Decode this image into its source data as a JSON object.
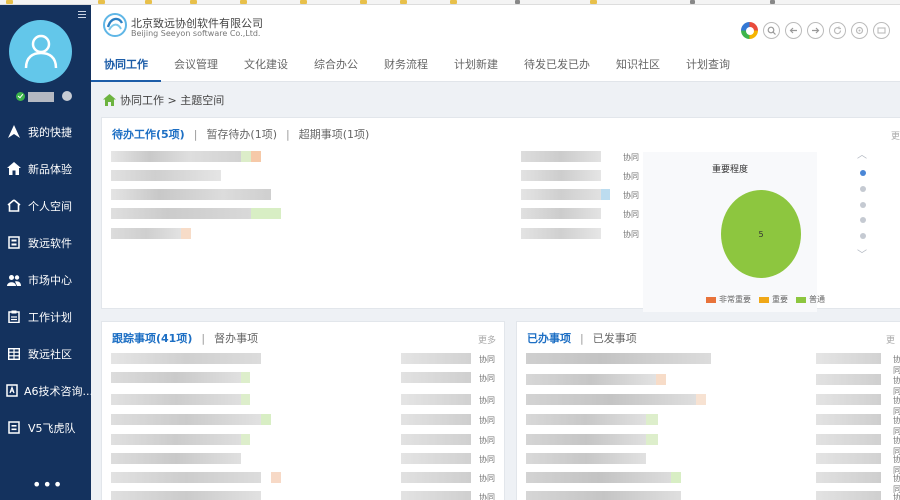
{
  "company": {
    "name_cn": "北京致远协创软件有限公司",
    "name_en": "Beijing Seeyon software Co.,Ltd."
  },
  "nav": {
    "items": [
      {
        "label": "我的快捷",
        "icon": "shortcut-icon"
      },
      {
        "label": "新品体验",
        "icon": "home-icon"
      },
      {
        "label": "个人空间",
        "icon": "personal-space-icon"
      },
      {
        "label": "致远软件",
        "icon": "building-icon"
      },
      {
        "label": "市场中心",
        "icon": "people-icon"
      },
      {
        "label": "工作计划",
        "icon": "clipboard-icon"
      },
      {
        "label": "致远社区",
        "icon": "grid-icon"
      },
      {
        "label": "A6技术咨询...",
        "icon": "a6-icon"
      },
      {
        "label": "V5飞虎队",
        "icon": "team-icon"
      }
    ],
    "more": "•••"
  },
  "tabs": [
    "协同工作",
    "会议管理",
    "文化建设",
    "综合办公",
    "财务流程",
    "计划新建",
    "待发已发已办",
    "知识社区",
    "计划查询"
  ],
  "breadcrumb": "协同工作 > 主题空间",
  "panel_todo": {
    "tab_active": "待办工作(5项)",
    "tab2": "暂存待办(1项)",
    "tab3": "超期事项(1项)",
    "more": "更",
    "row_type": "协同"
  },
  "chart_data": {
    "type": "pie",
    "title": "重要程度",
    "slices": [
      {
        "name": "普通",
        "value": 5,
        "color": "#8dc63f"
      }
    ],
    "data_label": "5",
    "legend": [
      {
        "name": "非常重要",
        "color": "#e8733a"
      },
      {
        "name": "重要",
        "color": "#f0a818"
      },
      {
        "name": "普通",
        "color": "#8dc63f"
      }
    ],
    "legend_position": "bottom"
  },
  "panel_follow": {
    "tab_active": "跟踪事项(41项)",
    "tab2": "督办事项",
    "more": "更多",
    "row_type": "协同"
  },
  "panel_done": {
    "tab_active": "已办事项",
    "tab2": "已发事项",
    "more": "更",
    "row_type": "协同"
  }
}
